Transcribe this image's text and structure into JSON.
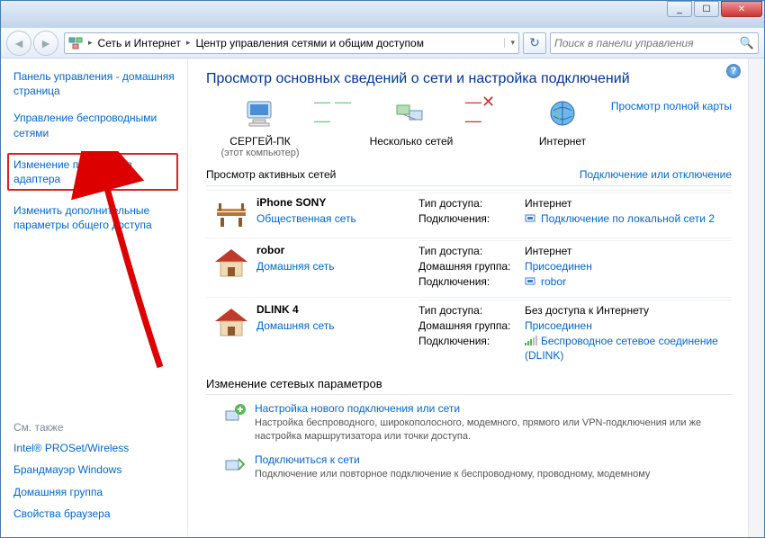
{
  "titlebar": {
    "min": "_",
    "max": "☐",
    "close": "✕"
  },
  "nav": {
    "crumb1": "Сеть и Интернет",
    "crumb2": "Центр управления сетями и общим доступом",
    "search_placeholder": "Поиск в панели управления"
  },
  "sidebar": {
    "cp_home": "Панель управления - домашняя страница",
    "wireless": "Управление беспроводными сетями",
    "adapter": "Изменение параметров адаптера",
    "sharing": "Изменить дополнительные параметры общего доступа",
    "seealso_head": "См. также",
    "seealso": {
      "proset": "Intel® PROSet/Wireless",
      "firewall": "Брандмауэр Windows",
      "homegroup": "Домашняя группа",
      "browser": "Свойства браузера"
    }
  },
  "main": {
    "heading": "Просмотр основных сведений о сети и настройка подключений",
    "fullmap": "Просмотр полной карты",
    "overview": {
      "computer": "СЕРГЕЙ-ПК",
      "computer_sub": "(этот компьютер)",
      "networks": "Несколько сетей",
      "internet": "Интернет"
    },
    "active_head": "Просмотр активных сетей",
    "active_link": "Подключение или отключение",
    "labels": {
      "access": "Тип доступа:",
      "homegroup": "Домашняя группа:",
      "connections": "Подключения:"
    },
    "vals": {
      "internet": "Интернет",
      "noaccess": "Без доступа к Интернету",
      "joined": "Присоединен"
    },
    "networks_list": [
      {
        "name": "iPhone SONY",
        "type": "Общественная сеть",
        "access": "internet",
        "conn_label": "Подключение по локальной сети 2",
        "icon": "bench"
      },
      {
        "name": "robor",
        "type": "Домашняя сеть",
        "access": "internet",
        "homegroup": true,
        "conn_label": "robor",
        "icon": "house"
      },
      {
        "name": "DLINK  4",
        "type": "Домашняя сеть",
        "access": "noaccess",
        "homegroup": true,
        "conn_label": "Беспроводное сетевое соединение (DLINK)",
        "icon": "house"
      }
    ],
    "change_head": "Изменение сетевых параметров",
    "tasks": {
      "t1_title": "Настройка нового подключения или сети",
      "t1_sub": "Настройка беспроводного, широкополосного, модемного, прямого или VPN-подключения или же настройка маршрутизатора или точки доступа.",
      "t2_title": "Подключиться к сети",
      "t2_sub": "Подключение или повторное подключение к беспроводному, проводному, модемному"
    }
  }
}
